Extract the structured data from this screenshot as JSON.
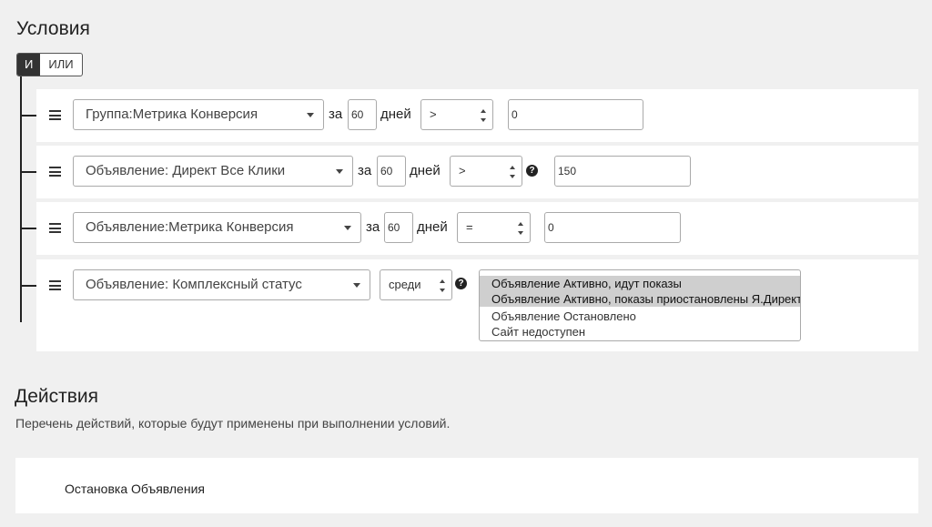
{
  "conditions": {
    "title": "Условия",
    "logic": {
      "and_label": "И",
      "or_label": "ИЛИ",
      "active": "and"
    },
    "rows": [
      {
        "metric": "Группа:Метрика Конверсия",
        "period_prefix": "за",
        "days": "60",
        "days_label": "дней",
        "operator": ">",
        "value": "0"
      },
      {
        "metric": "Объявление: Директ Все Клики",
        "period_prefix": "за",
        "days": "60",
        "days_label": "дней",
        "operator": ">",
        "help": "?",
        "value": "150"
      },
      {
        "metric": "Объявление:Метрика Конверсия",
        "period_prefix": "за",
        "days": "60",
        "days_label": "дней",
        "operator": "=",
        "value": "0"
      },
      {
        "metric": "Объявление: Комплексный статус",
        "operator": "среди",
        "help": "?",
        "options": [
          {
            "label": "Объявление Активно, идут показы",
            "selected": true
          },
          {
            "label": "Объявление Активно, показы приостановлены Я.Директ",
            "selected": true
          },
          {
            "label": "Объявление Остановлено",
            "selected": false
          },
          {
            "label": "Сайт недоступен",
            "selected": false
          }
        ]
      }
    ]
  },
  "actions": {
    "title": "Действия",
    "description": "Перечень действий, которые будут применены при выполнении условий.",
    "items": [
      {
        "label": "Остановка Объявления"
      }
    ]
  }
}
